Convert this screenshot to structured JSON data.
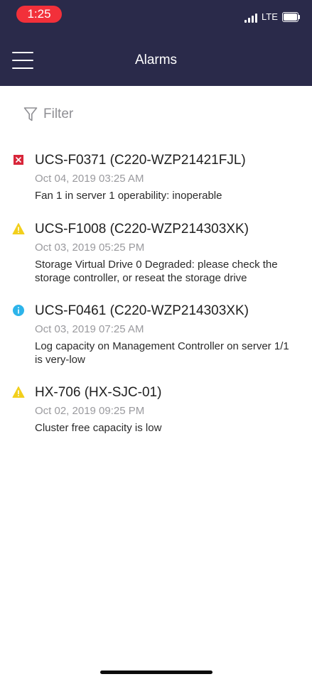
{
  "status_bar": {
    "time": "1:25",
    "network": "LTE"
  },
  "header": {
    "title": "Alarms",
    "menu_icon": "hamburger-menu-icon"
  },
  "filter": {
    "label": "Filter",
    "icon": "filter-funnel-icon"
  },
  "alarms": [
    {
      "severity": "critical",
      "icon": "critical-x-icon",
      "title": "UCS-F0371 (C220-WZP21421FJL)",
      "time": "Oct 04, 2019 03:25 AM",
      "description": "Fan 1 in server 1 operability: inoperable"
    },
    {
      "severity": "warning",
      "icon": "warning-triangle-icon",
      "title": "UCS-F1008 (C220-WZP214303XK)",
      "time": "Oct 03, 2019 05:25 PM",
      "description": "Storage Virtual Drive 0 Degraded: please check the storage controller, or reseat the storage drive"
    },
    {
      "severity": "info",
      "icon": "info-circle-icon",
      "title": "UCS-F0461 (C220-WZP214303XK)",
      "time": "Oct 03, 2019 07:25 AM",
      "description": "Log capacity on Management Controller on server 1/1 is very-low"
    },
    {
      "severity": "warning",
      "icon": "warning-triangle-icon",
      "title": "HX-706 (HX-SJC-01)",
      "time": "Oct 02, 2019 09:25 PM",
      "description": "Cluster free capacity is low"
    }
  ],
  "colors": {
    "header_bg": "#2a2a4a",
    "critical": "#d8263a",
    "warning": "#f2cf1c",
    "info": "#2db4ea",
    "status_time_bg": "#f2303a"
  }
}
